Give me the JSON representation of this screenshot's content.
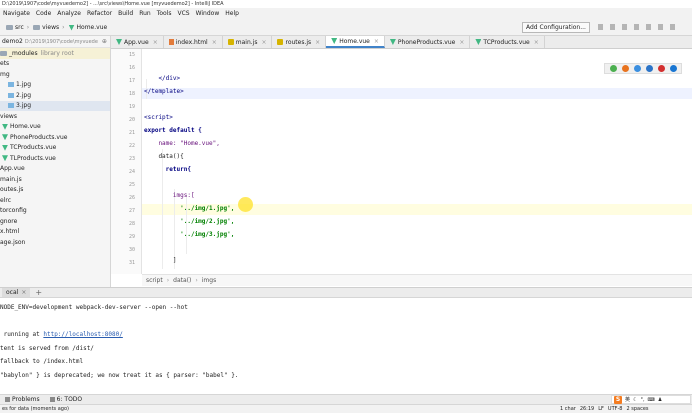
{
  "window": {
    "title": "D:\\2019\\1907\\code\\myvuedemo2] - ...\\src\\views\\Home.vue [myvuedemo2] - IntelliJ IDEA"
  },
  "menu": [
    "Navigate",
    "Code",
    "Analyze",
    "Refactor",
    "Build",
    "Run",
    "Tools",
    "VCS",
    "Window",
    "Help"
  ],
  "nav": {
    "crumbs": [
      "src",
      "views",
      "Home.vue"
    ],
    "add_config": "Add Configuration..."
  },
  "project": {
    "name": "demo2",
    "path": "D:\\2019\\1907\\code\\myvuede"
  },
  "tree": [
    {
      "label": "_modules",
      "note": "library root"
    },
    {
      "label": "ets",
      "note": ""
    },
    {
      "label": "mg",
      "note": ""
    },
    {
      "label": "1.jpg",
      "note": ""
    },
    {
      "label": "2.jpg",
      "note": ""
    },
    {
      "label": "3.jpg",
      "note": ""
    },
    {
      "label": "views",
      "note": ""
    },
    {
      "label": "Home.vue",
      "note": ""
    },
    {
      "label": "PhoneProducts.vue",
      "note": ""
    },
    {
      "label": "TCProducts.vue",
      "note": ""
    },
    {
      "label": "TLProducts.vue",
      "note": ""
    },
    {
      "label": "App.vue",
      "note": ""
    },
    {
      "label": "main.js",
      "note": ""
    },
    {
      "label": "outes.js",
      "note": ""
    },
    {
      "label": "elrc",
      "note": ""
    },
    {
      "label": "torconfig",
      "note": ""
    },
    {
      "label": "gnore",
      "note": ""
    },
    {
      "label": "x.html",
      "note": ""
    },
    {
      "label": "age.json",
      "note": ""
    }
  ],
  "tabs": [
    {
      "label": "App.vue",
      "active": false
    },
    {
      "label": "index.html",
      "active": false
    },
    {
      "label": "main.js",
      "active": false
    },
    {
      "label": "routes.js",
      "active": false
    },
    {
      "label": "Home.vue",
      "active": true
    },
    {
      "label": "PhoneProducts.vue",
      "active": false
    },
    {
      "label": "TCProducts.vue",
      "active": false
    }
  ],
  "editor": {
    "line_numbers": [
      "15",
      "16",
      "17",
      "18",
      "19",
      "20",
      "21",
      "22",
      "23",
      "24",
      "25",
      "26",
      "27",
      "28",
      "29",
      "30",
      "31"
    ],
    "code": [
      "",
      "",
      "    </div>",
      "</template>",
      "",
      "<script>",
      "export default {",
      "    name: \"Home.vue\",",
      "    data(){",
      "      return{",
      "",
      "        imgs:[",
      "          '../img/1.jpg',",
      "          '../img/2.jpg',",
      "          '../img/3.jpg',",
      "",
      "        ]"
    ],
    "breadcrumb": [
      "script",
      "data()",
      "imgs"
    ]
  },
  "terminal": {
    "tab_label": "ocal",
    "lines": [
      "",
      "NODE_ENV=development webpack-dev-server --open --hot",
      "",
      "",
      " running at ",
      "",
      "tent is served from /dist/",
      "fallback to /index.html",
      "",
      "\"babylon\" } is deprecated; we now treat it as { parser: \"babel\" }."
    ],
    "link": "http://localhost:8080/"
  },
  "toolwindows": [
    {
      "label": "Problems"
    },
    {
      "label": "6: TODO"
    }
  ],
  "status": {
    "message": "es for data (moments ago)",
    "right": [
      "1 char",
      "26:19",
      "LF",
      "UTF-8",
      "2 spaces"
    ]
  },
  "ime": {
    "label": "英"
  },
  "colors": {
    "accent": "#4083c9",
    "vue_green": "#41b883"
  }
}
